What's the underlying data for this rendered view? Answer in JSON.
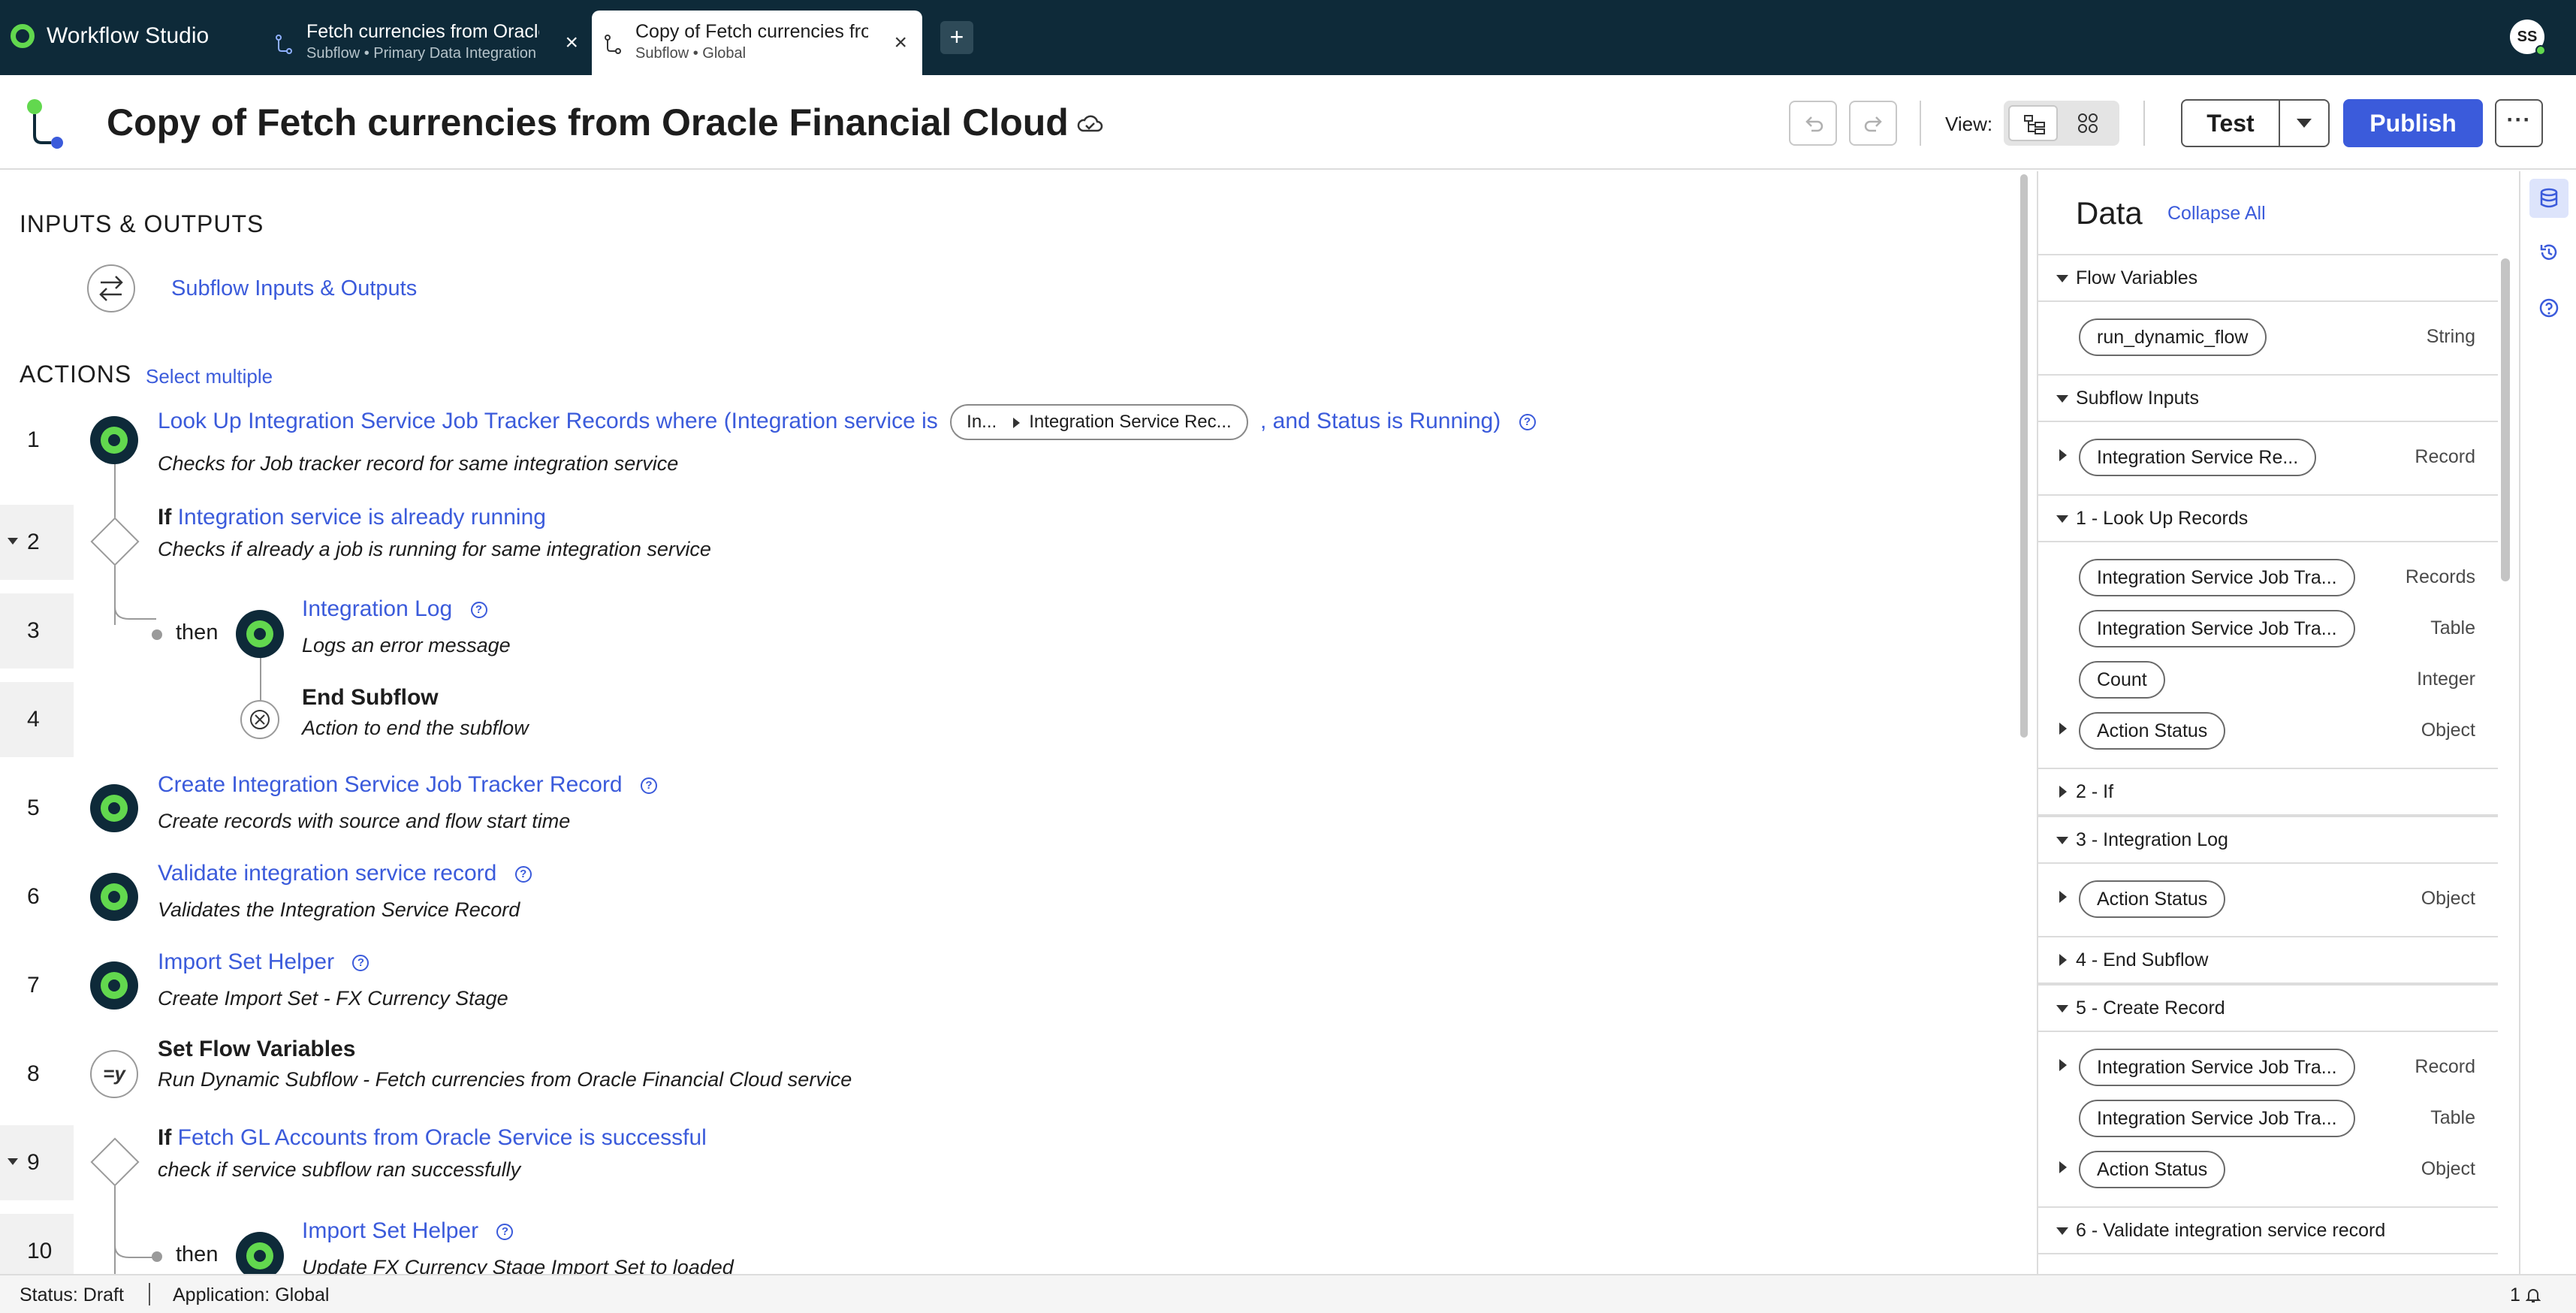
{
  "app": {
    "name": "Workflow Studio",
    "accent_color": "#3b5bdb",
    "brand_color": "#62d84e",
    "topbar_color": "#0e2a39"
  },
  "tabs": [
    {
      "title": "Fetch currencies from Oracle Financial Cloud",
      "subtitle": "Subflow • Primary Data Integration",
      "icon": "subflow-icon"
    },
    {
      "title": "Copy of Fetch currencies from Oracle Financial Cloud",
      "subtitle": "Subflow • Global",
      "icon": "subflow-icon"
    }
  ],
  "add_tab": "+",
  "user": {
    "initials": "SS"
  },
  "header": {
    "title": "Copy of Fetch currencies from Oracle Financial Cloud",
    "view_label": "View:",
    "test_label": "Test",
    "publish_label": "Publish",
    "more_label": "···"
  },
  "inputs_outputs": {
    "heading": "INPUTS & OUTPUTS",
    "link": "Subflow Inputs & Outputs"
  },
  "actions": {
    "heading": "ACTIONS",
    "select_multiple": "Select multiple",
    "then_label": "then",
    "steps": [
      {
        "num": "1",
        "title_pre": "Look Up Integration Service Job Tracker Records where (Integration service is",
        "pill_a": "In...",
        "pill_b": "Integration Service Rec...",
        "title_post": ", and Status is Running)",
        "desc": "Checks for Job tracker record for same integration service"
      },
      {
        "num": "2",
        "keyword": "If",
        "title": "Integration service is already running",
        "desc": "Checks if already a job is running for same integration service"
      },
      {
        "num": "3",
        "title": "Integration Log",
        "desc": "Logs an error message"
      },
      {
        "num": "4",
        "title": "End Subflow",
        "desc": "Action to end the subflow"
      },
      {
        "num": "5",
        "title": "Create Integration Service Job Tracker Record",
        "desc": "Create records with source and flow start time"
      },
      {
        "num": "6",
        "title": "Validate integration service record",
        "desc": "Validates the Integration Service Record"
      },
      {
        "num": "7",
        "title": "Import Set Helper",
        "desc": "Create Import Set - FX Currency Stage"
      },
      {
        "num": "8",
        "title": "Set Flow Variables",
        "node_label": "=y",
        "desc": "Run Dynamic Subflow - Fetch currencies from Oracle Financial Cloud service"
      },
      {
        "num": "9",
        "keyword": "If",
        "title": "Fetch GL Accounts from Oracle Service is successful",
        "desc": "check if service subflow ran successfully"
      },
      {
        "num": "10",
        "title": "Import Set Helper",
        "desc": "Update FX Currency Stage Import Set to loaded"
      }
    ]
  },
  "data_panel": {
    "title": "Data",
    "collapse_all": "Collapse All",
    "groups": [
      {
        "label": "Flow Variables",
        "expanded": true,
        "items": [
          {
            "pill": "run_dynamic_flow",
            "type": "String",
            "expandable": false
          }
        ]
      },
      {
        "label": "Subflow Inputs",
        "expanded": true,
        "items": [
          {
            "pill": "Integration Service Re...",
            "type": "Record",
            "expandable": true
          }
        ]
      },
      {
        "label": "1 - Look Up Records",
        "expanded": true,
        "items": [
          {
            "pill": "Integration Service Job Tra...",
            "type": "Records",
            "expandable": false
          },
          {
            "pill": "Integration Service Job Tra...",
            "type": "Table",
            "expandable": false
          },
          {
            "pill": "Count",
            "type": "Integer",
            "expandable": false
          },
          {
            "pill": "Action Status",
            "type": "Object",
            "expandable": true
          }
        ]
      },
      {
        "label": "2 - If",
        "expanded": false,
        "items": []
      },
      {
        "label": "3 - Integration Log",
        "expanded": true,
        "items": [
          {
            "pill": "Action Status",
            "type": "Object",
            "expandable": true
          }
        ]
      },
      {
        "label": "4 - End Subflow",
        "expanded": false,
        "items": []
      },
      {
        "label": "5 - Create Record",
        "expanded": true,
        "items": [
          {
            "pill": "Integration Service Job Tra...",
            "type": "Record",
            "expandable": true
          },
          {
            "pill": "Integration Service Job Tra...",
            "type": "Table",
            "expandable": false
          },
          {
            "pill": "Action Status",
            "type": "Object",
            "expandable": true
          }
        ]
      },
      {
        "label": "6 - Validate integration service record",
        "expanded": true,
        "items": []
      }
    ]
  },
  "right_strip": [
    "database-icon",
    "history-icon",
    "help-icon"
  ],
  "status": {
    "state": "Status: Draft",
    "application": "Application: Global",
    "notifications": "1"
  }
}
